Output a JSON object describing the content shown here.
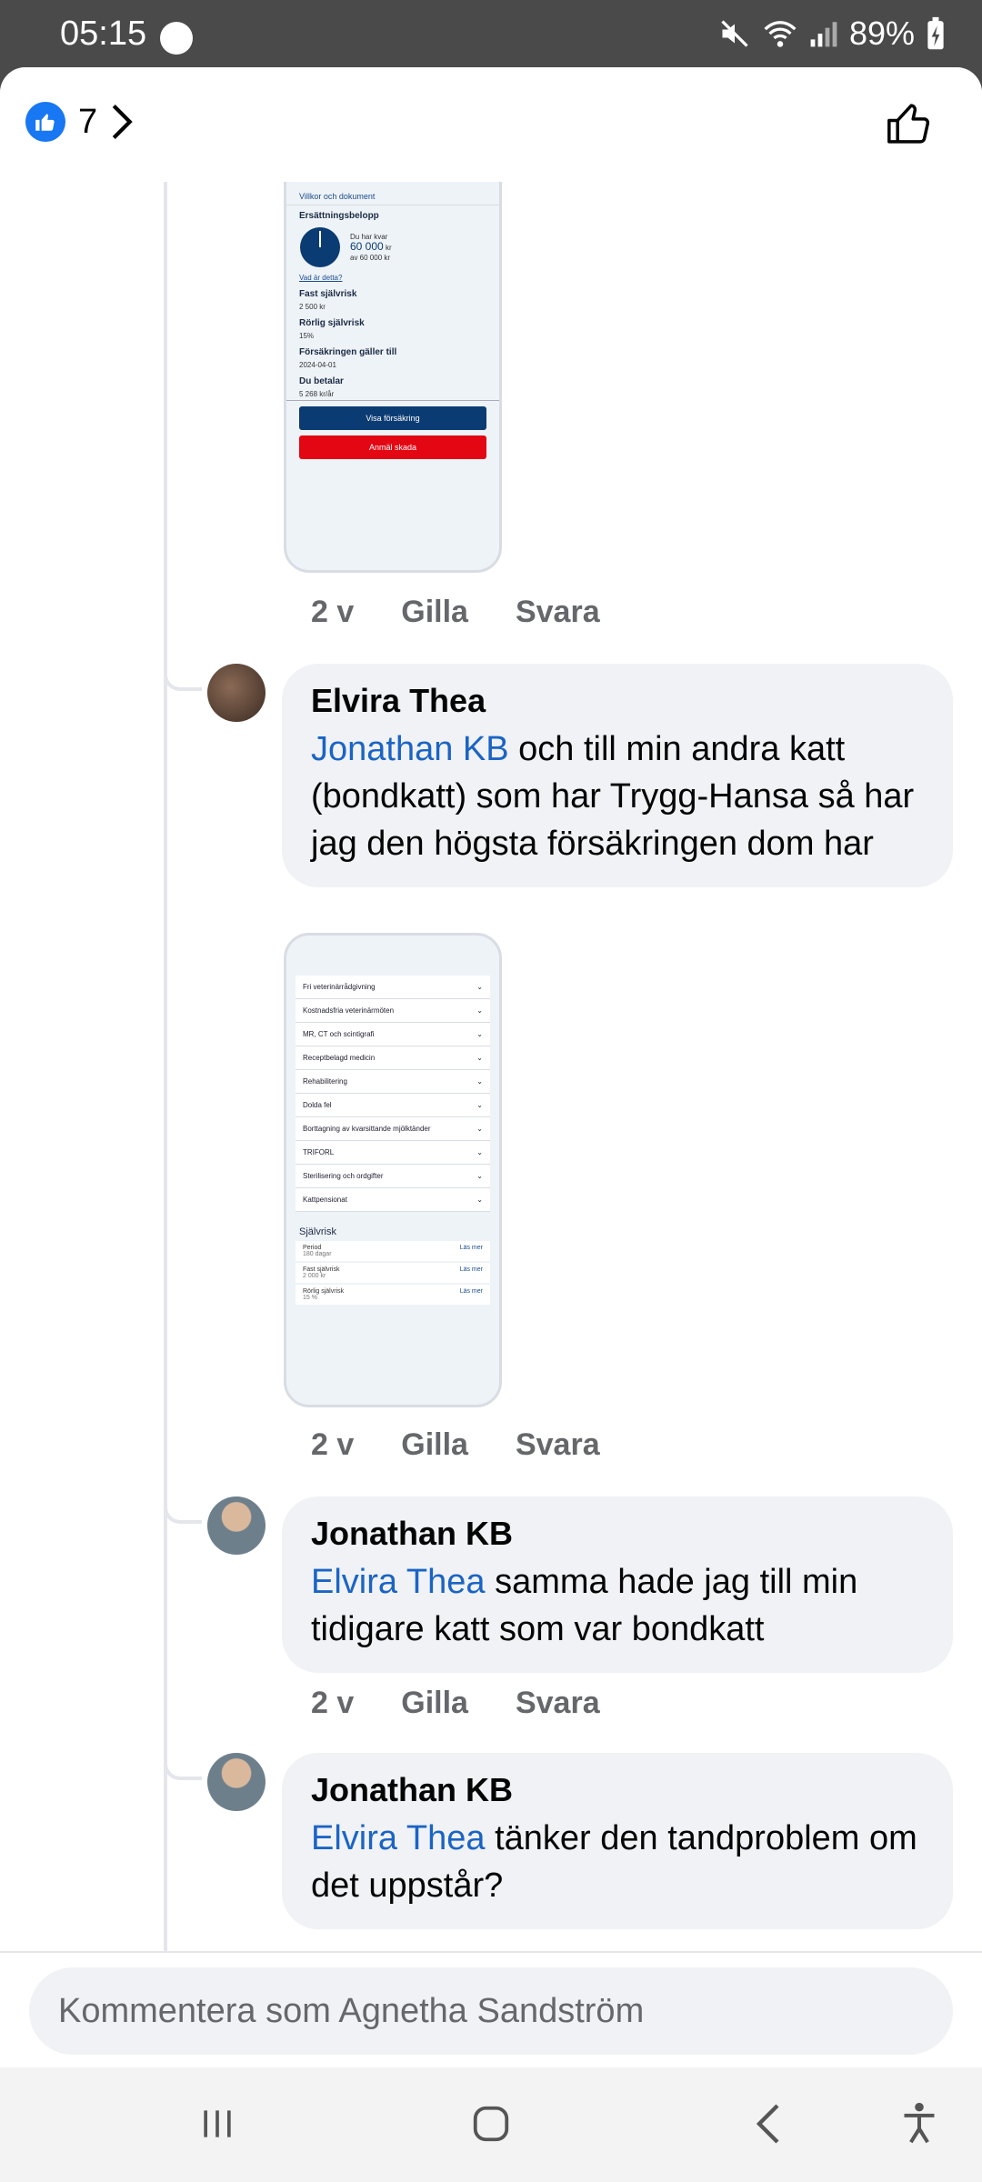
{
  "status": {
    "time": "05:15",
    "battery": "89%"
  },
  "header": {
    "like_count": "7"
  },
  "screenshot1": {
    "row": "Villkor och dokument",
    "section_ersattning": "Ersättningsbelopp",
    "gauge_line1": "Du har kvar",
    "gauge_amount": "60 000",
    "gauge_unit": "kr",
    "gauge_total": "av 60 000 kr",
    "info_link": "Vad är detta?",
    "fast_label": "Fast självrisk",
    "fast_value": "2 500 kr",
    "rorlig_label": "Rörlig självrisk",
    "rorlig_value": "15%",
    "galler_label": "Försäkringen gäller till",
    "galler_value": "2024-04-01",
    "betalar_label": "Du betalar",
    "betalar_value": "5 268 kr/år",
    "btn_visa": "Visa försäkring",
    "btn_anmal": "Anmäl skada"
  },
  "screenshot2": {
    "rows": [
      "Fri veterinärrådgivning",
      "Kostnadsfria veterinärmöten",
      "MR, CT och scintigrafi",
      "Receptbelagd medicin",
      "Rehabilitering",
      "Dolda fel",
      "Borttagning av kvarsittande mjölktänder",
      "TRIFORL",
      "Sterilisering och ordgifter",
      "Kattpensionat"
    ],
    "section": "Självrisk",
    "risk_rows": [
      {
        "label": "Period",
        "value": "180 dagar",
        "link": "Läs mer"
      },
      {
        "label": "Fast självrisk",
        "value": "2 000 kr",
        "link": "Läs mer"
      },
      {
        "label": "Rörlig självrisk",
        "value": "15 %",
        "link": "Läs mer"
      }
    ]
  },
  "actions": {
    "time": "2 v",
    "like": "Gilla",
    "reply": "Svara"
  },
  "comments": [
    {
      "author": "Elvira Thea",
      "mention": "Jonathan KB",
      "text": " och till min andra katt (bondkatt) som har Trygg-Hansa så har jag den högsta försäkringen dom har"
    },
    {
      "author": "Jonathan KB",
      "mention": "Elvira Thea",
      "text": " samma hade jag till min tidigare katt som var bondkatt"
    },
    {
      "author": "Jonathan KB",
      "mention": "Elvira Thea",
      "text": " tänker den tandproblem om det uppstår?"
    }
  ],
  "composer": {
    "placeholder": "Kommentera som Agnetha Sandström"
  },
  "colors": {
    "accent": "#1877f2",
    "mention": "#1b64c4",
    "bubble": "#f0f2f5",
    "visa_button": "#0b3b73",
    "anmal_button": "#e30613"
  }
}
